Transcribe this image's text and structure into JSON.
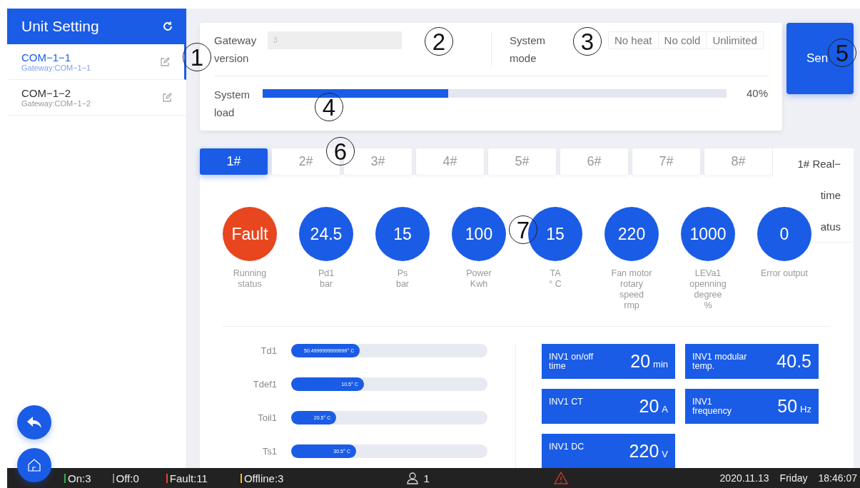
{
  "sidebar": {
    "title": "Unit Setting",
    "items": [
      {
        "name": "COM−1−1",
        "sub": "Gateway:COM−1−1",
        "selected": true
      },
      {
        "name": "COM−1−2",
        "sub": "Gateway:COM−1−2",
        "selected": false
      }
    ]
  },
  "settings": {
    "gateway_label": "Gateway version",
    "gateway_value": "3",
    "mode_label": "System mode",
    "modes": [
      {
        "label": "No heat",
        "selected": false
      },
      {
        "label": "No cold",
        "selected": false
      },
      {
        "label": "Unlimited",
        "selected": false
      }
    ],
    "load_label": "System load",
    "load": {
      "level": 0.4,
      "reading": "40%"
    },
    "send_button": "Sen"
  },
  "unit_tabs": [
    {
      "label": "1#",
      "selected": true
    },
    {
      "label": "2#",
      "selected": false
    },
    {
      "label": "3#",
      "selected": false
    },
    {
      "label": "4#",
      "selected": false
    },
    {
      "label": "5#",
      "selected": false
    },
    {
      "label": "6#",
      "selected": false
    },
    {
      "label": "7#",
      "selected": false
    },
    {
      "label": "8#",
      "selected": false
    }
  ],
  "realtime_label": [
    "1# Real−",
    "time",
    "atus"
  ],
  "metrics": [
    {
      "value": "Fault",
      "label": [
        "Running",
        "status"
      ],
      "color": "#e8461e"
    },
    {
      "value": "24.5",
      "label": [
        "Pd1",
        "bar"
      ],
      "color": "#1a5ce6"
    },
    {
      "value": "15",
      "label": [
        "Ps",
        "bar"
      ],
      "color": "#1a5ce6"
    },
    {
      "value": "100",
      "label": [
        "Power",
        "Kwh"
      ],
      "color": "#1a5ce6"
    },
    {
      "value": "15",
      "label": [
        "TA",
        "° C"
      ],
      "color": "#1a5ce6"
    },
    {
      "value": "220",
      "label": [
        "Fan motor",
        "rotary",
        "speed",
        "rmp"
      ],
      "color": "#1a5ce6"
    },
    {
      "value": "1000",
      "label": [
        "LEVa1",
        "openning",
        "degree",
        "%"
      ],
      "color": "#1a5ce6"
    },
    {
      "value": "0",
      "label": [
        "Error output"
      ],
      "color": "#1a5ce6"
    }
  ],
  "temperatures": [
    {
      "name": "Td1",
      "reading": "50.4999999999999° C",
      "level": 0.35
    },
    {
      "name": "Tdef1",
      "reading": "10.5° C",
      "level": 0.37
    },
    {
      "name": "Toil1",
      "reading": "20.5° C",
      "level": 0.23
    },
    {
      "name": "Ts1",
      "reading": "30.5° C",
      "level": 0.33
    }
  ],
  "inverter": [
    {
      "label": "INV1 on/off time",
      "value": "20",
      "unit": "min"
    },
    {
      "label": "INV1 modular temp.",
      "value": "40.5"
    },
    {
      "label": "INV1 CT",
      "value": "20",
      "unit": "A"
    },
    {
      "label": "INV1 frequency",
      "value": "50",
      "unit": "Hz"
    },
    {
      "label": "INV1 DC",
      "value": "220",
      "unit": "V"
    }
  ],
  "status_bar": {
    "counts": [
      {
        "label": "On:3",
        "color": "#2fb34a"
      },
      {
        "label": "Off:0",
        "color": "#888888"
      },
      {
        "label": "Fault:11",
        "color": "#e8461e"
      },
      {
        "label": "Offline:3",
        "color": "#f2c21b"
      }
    ],
    "users": "1",
    "date": "2020.11.13",
    "weekday": "Friday",
    "time": "18:46:07"
  },
  "callouts": [
    "1",
    "2",
    "3",
    "4",
    "5",
    "6",
    "7"
  ]
}
